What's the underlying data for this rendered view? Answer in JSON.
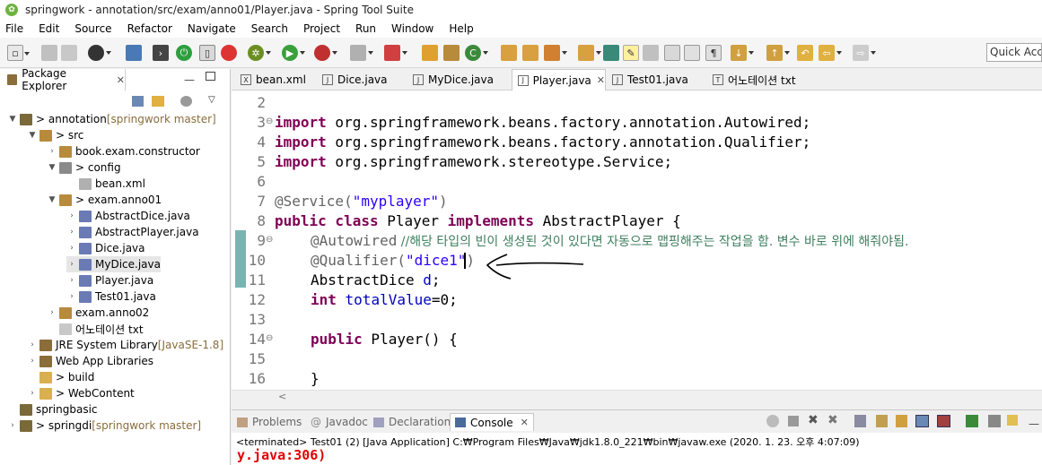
{
  "window": {
    "title": "springwork - annotation/src/exam/anno01/Player.java - Spring Tool Suite"
  },
  "menu": [
    "File",
    "Edit",
    "Source",
    "Refactor",
    "Navigate",
    "Search",
    "Project",
    "Run",
    "Window",
    "Help"
  ],
  "quick_access": {
    "placeholder": "Quick Access"
  },
  "package_explorer": {
    "title": "Package Explorer",
    "tree": [
      {
        "arrow": "▼",
        "label": "> annotation",
        "deco": " [springwork master]",
        "icon": "project"
      },
      {
        "arrow": "▼",
        "label": "> src",
        "deco": "",
        "icon": "srcfolder"
      },
      {
        "arrow": "›",
        "label": "book.exam.constructor",
        "deco": "",
        "icon": "package"
      },
      {
        "arrow": "▼",
        "label": "> config",
        "deco": "",
        "icon": "package2"
      },
      {
        "arrow": "",
        "label": "bean.xml",
        "deco": "",
        "icon": "xml"
      },
      {
        "arrow": "▼",
        "label": "> exam.anno01",
        "deco": "",
        "icon": "package"
      },
      {
        "arrow": "›",
        "label": "AbstractDice.java",
        "deco": "",
        "icon": "java"
      },
      {
        "arrow": "›",
        "label": "AbstractPlayer.java",
        "deco": "",
        "icon": "java"
      },
      {
        "arrow": "›",
        "label": "Dice.java",
        "deco": "",
        "icon": "java"
      },
      {
        "arrow": "›",
        "label": "MyDice.java",
        "deco": "",
        "icon": "java"
      },
      {
        "arrow": "›",
        "label": "Player.java",
        "deco": "",
        "icon": "java"
      },
      {
        "arrow": "›",
        "label": "Test01.java",
        "deco": "",
        "icon": "java"
      },
      {
        "arrow": "›",
        "label": "exam.anno02",
        "deco": "",
        "icon": "package"
      },
      {
        "arrow": "",
        "label": "어노테이션 txt",
        "deco": "",
        "icon": "txt"
      },
      {
        "arrow": "›",
        "label": "JRE System Library",
        "deco": " [JavaSE-1.8]",
        "icon": "lib"
      },
      {
        "arrow": "›",
        "label": "Web App Libraries",
        "deco": "",
        "icon": "lib"
      },
      {
        "arrow": "",
        "label": "> build",
        "deco": "",
        "icon": "folder"
      },
      {
        "arrow": "›",
        "label": "> WebContent",
        "deco": "",
        "icon": "folder"
      },
      {
        "arrow": "",
        "label": "springbasic",
        "deco": "",
        "icon": "project2"
      },
      {
        "arrow": "›",
        "label": "> springdi",
        "deco": " [springwork master]",
        "icon": "project"
      }
    ]
  },
  "editor_tabs": [
    {
      "label": "bean.xml",
      "icon": "X"
    },
    {
      "label": "Dice.java",
      "icon": "J"
    },
    {
      "label": "MyDice.java",
      "icon": "J"
    },
    {
      "label": "Player.java",
      "icon": "J",
      "active": true
    },
    {
      "label": "Test01.java",
      "icon": "J"
    },
    {
      "label": "어노테이션 txt",
      "icon": "T"
    }
  ],
  "code_lines": [
    {
      "n": "2",
      "fold": ""
    },
    {
      "n": "3",
      "fold": "⊖"
    },
    {
      "n": "4",
      "fold": ""
    },
    {
      "n": "5",
      "fold": ""
    },
    {
      "n": "6",
      "fold": ""
    },
    {
      "n": "7",
      "fold": ""
    },
    {
      "n": "8",
      "fold": ""
    },
    {
      "n": "9",
      "fold": "⊖"
    },
    {
      "n": "10",
      "fold": ""
    },
    {
      "n": "11",
      "fold": ""
    },
    {
      "n": "12",
      "fold": ""
    },
    {
      "n": "13",
      "fold": ""
    },
    {
      "n": "14",
      "fold": "⊖"
    },
    {
      "n": "15",
      "fold": ""
    },
    {
      "n": "16",
      "fold": ""
    }
  ],
  "code": {
    "l3_kw": "import",
    "l3_rest": " org.springframework.beans.factory.annotation.Autowired;",
    "l4_kw": "import",
    "l4_rest": " org.springframework.beans.factory.annotation.Qualifier;",
    "l5_kw": "import",
    "l5_rest": " org.springframework.stereotype.Service;",
    "l7_ann": "@Service(",
    "l7_str": "\"myplayer\"",
    "l7_end": ")",
    "l8_kw1": "public class",
    "l8_mid": " Player ",
    "l8_kw2": "implements",
    "l8_end": " AbstractPlayer {",
    "l9_ann": "@Autowired",
    "l9_cmt": " //해당 타입의 빈이 생성된 것이 있다면 자동으로 맵핑해주는 작업을 함. 변수 바로 위에 해줘야됨.",
    "l10_ann": "@Qualifier(",
    "l10_str": "\"dice1\"",
    "l10_end": ")",
    "l11_type": "AbstractDice ",
    "l11_fld": "d",
    ";": ";",
    "l12_kw": "int",
    "l12_fld": " totalValue",
    "l12_end": "=0;",
    "l14_kw": "public",
    "l14_end": " Player() {",
    "l16_end": "}"
  },
  "console_tabs": [
    {
      "label": "Problems",
      "active": false
    },
    {
      "label": "Javadoc",
      "active": false
    },
    {
      "label": "Declaration",
      "active": false
    },
    {
      "label": "Console",
      "active": true
    }
  ],
  "console": {
    "status": "<terminated> Test01 (2) [Java Application] C:₩Program Files₩Java₩jdk1.8.0_221₩bin₩javaw.exe (2020. 1. 23. 오후 4:07:09)",
    "error": "y.java:306)"
  },
  "colors": {
    "keyword": "#7f0055",
    "string": "#2a00ff",
    "annotation": "#646464",
    "comment": "#3f7f5f",
    "field": "#0000c0",
    "error": "#e00000"
  }
}
